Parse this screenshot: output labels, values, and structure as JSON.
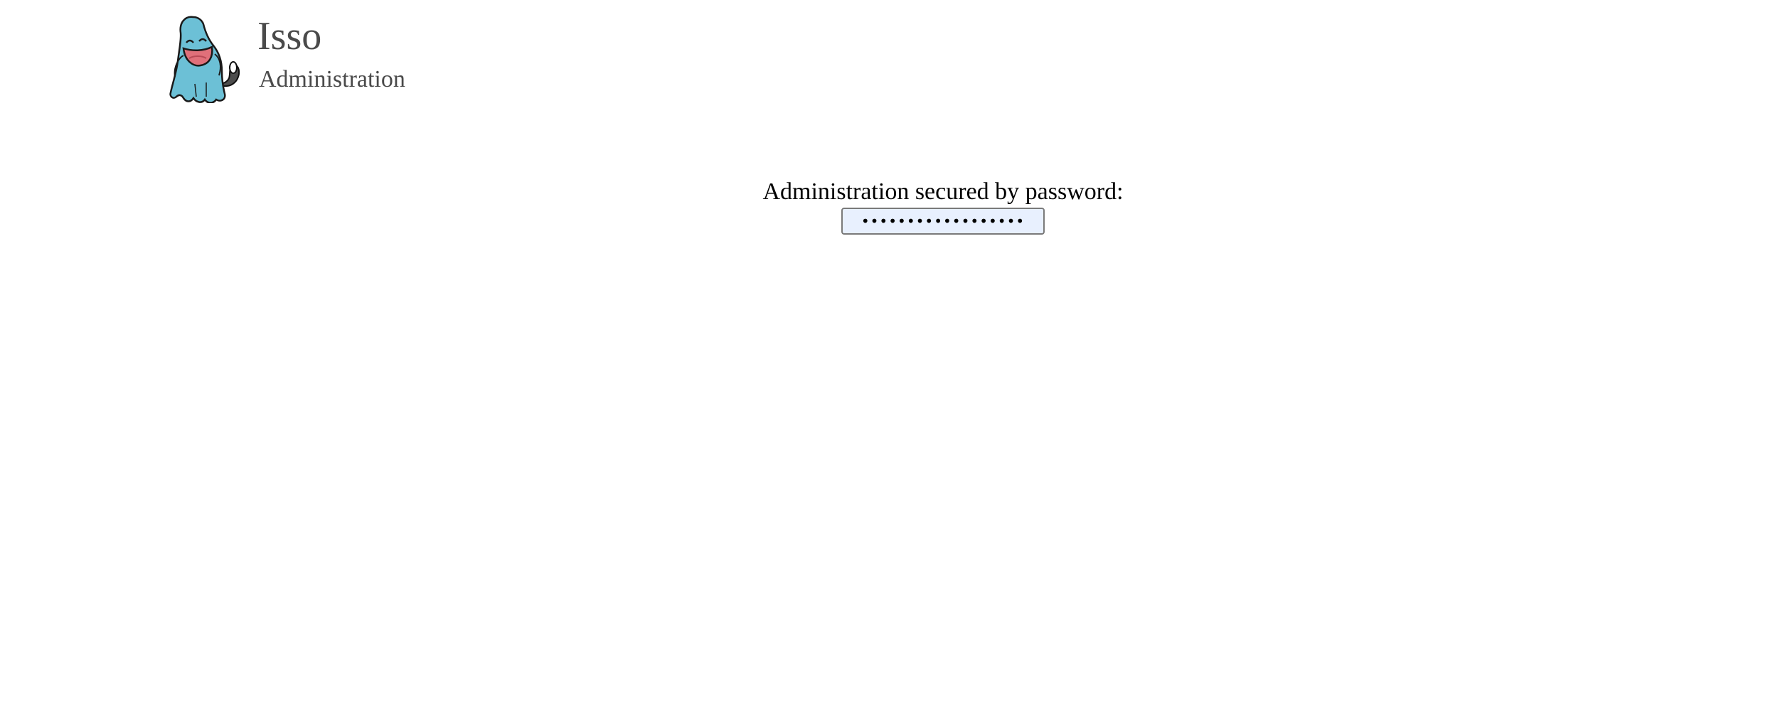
{
  "header": {
    "logo_icon": "wobbuffet-mascot-icon",
    "title": "Isso",
    "subtitle": "Administration"
  },
  "login": {
    "label": "Administration secured by password:",
    "password_value": "••••••••••••••••••"
  },
  "colors": {
    "title_text": "#4a4a4a",
    "mascot_body": "#6cc0d6",
    "mascot_mouth": "#e0707a",
    "input_background": "#e8f0fe"
  }
}
